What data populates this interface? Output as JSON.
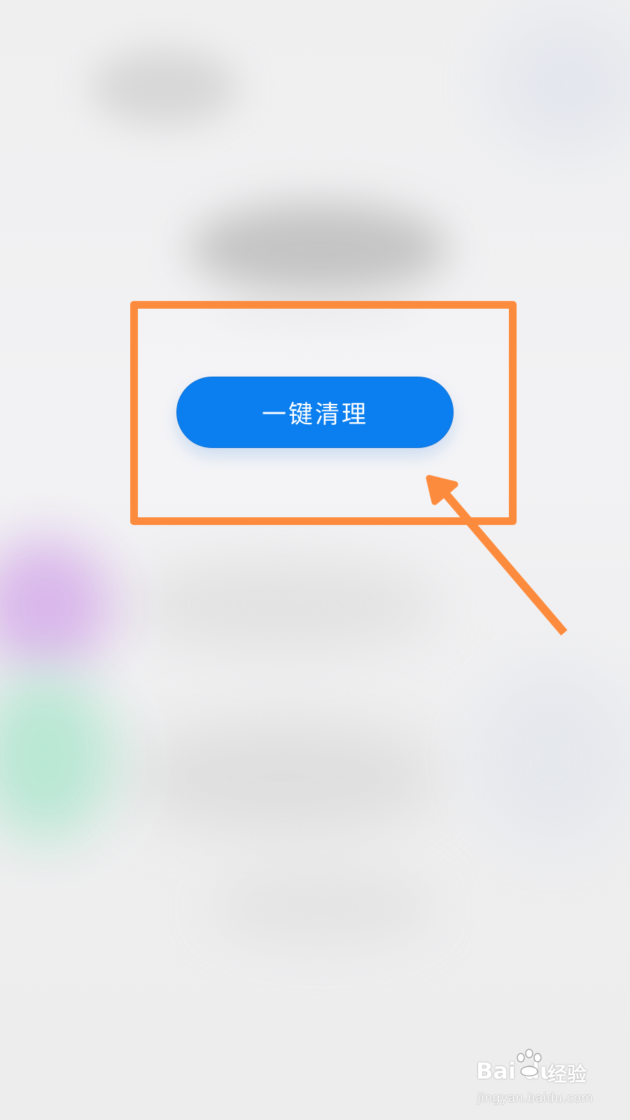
{
  "main": {
    "clean_button_label": "一键清理"
  },
  "annotation": {
    "color": "#fd8b3d",
    "shape": "rectangle-with-arrow"
  },
  "button": {
    "color": "#0b7ff0"
  },
  "watermark": {
    "brand": "Bai du",
    "brand_cn": "经验",
    "url": "jingyan.baidu.com"
  }
}
